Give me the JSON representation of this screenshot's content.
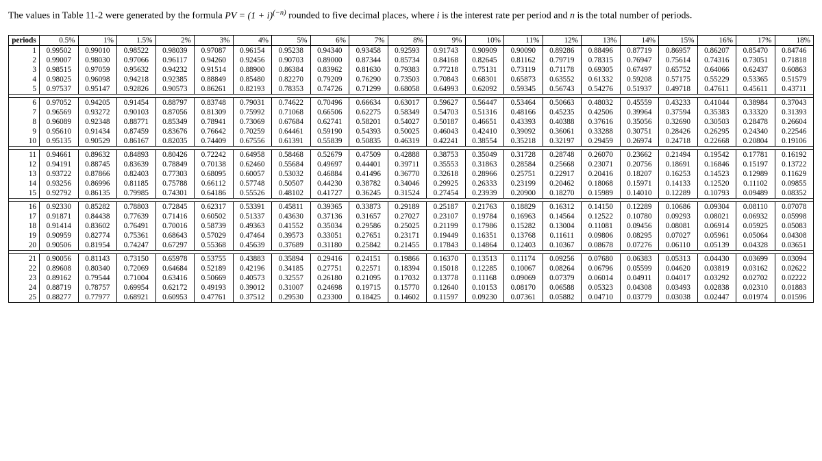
{
  "intro_before": "The values in Table 11-2 were generated by the formula ",
  "intro_formula_html": "PV = (1 + i)<span class='sup'>(−n)</span>",
  "intro_after": " rounded to five decimal places, where ",
  "intro_i": "i",
  "intro_mid": " is the interest rate per period and ",
  "intro_n": "n",
  "intro_end": " is the total number of periods.",
  "periods_label": "periods",
  "rates": [
    "0.5%",
    "1%",
    "1.5%",
    "2%",
    "3%",
    "4%",
    "5%",
    "6%",
    "7%",
    "8%",
    "9%",
    "10%",
    "11%",
    "12%",
    "13%",
    "14%",
    "15%",
    "16%",
    "17%",
    "18%"
  ],
  "chart_data": {
    "type": "table",
    "title": "Present Value Interest Factors PV = (1+i)^(-n)",
    "columns": [
      "periods",
      "0.5%",
      "1%",
      "1.5%",
      "2%",
      "3%",
      "4%",
      "5%",
      "6%",
      "7%",
      "8%",
      "9%",
      "10%",
      "11%",
      "12%",
      "13%",
      "14%",
      "15%",
      "16%",
      "17%",
      "18%"
    ],
    "groups": [
      {
        "periods": [
          1,
          2,
          3,
          4,
          5
        ],
        "rows": [
          [
            "0.99502",
            "0.99010",
            "0.98522",
            "0.98039",
            "0.97087",
            "0.96154",
            "0.95238",
            "0.94340",
            "0.93458",
            "0.92593",
            "0.91743",
            "0.90909",
            "0.90090",
            "0.89286",
            "0.88496",
            "0.87719",
            "0.86957",
            "0.86207",
            "0.85470",
            "0.84746"
          ],
          [
            "0.99007",
            "0.98030",
            "0.97066",
            "0.96117",
            "0.94260",
            "0.92456",
            "0.90703",
            "0.89000",
            "0.87344",
            "0.85734",
            "0.84168",
            "0.82645",
            "0.81162",
            "0.79719",
            "0.78315",
            "0.76947",
            "0.75614",
            "0.74316",
            "0.73051",
            "0.71818"
          ],
          [
            "0.98515",
            "0.97059",
            "0.95632",
            "0.94232",
            "0.91514",
            "0.88900",
            "0.86384",
            "0.83962",
            "0.81630",
            "0.79383",
            "0.77218",
            "0.75131",
            "0.73119",
            "0.71178",
            "0.69305",
            "0.67497",
            "0.65752",
            "0.64066",
            "0.62437",
            "0.60863"
          ],
          [
            "0.98025",
            "0.96098",
            "0.94218",
            "0.92385",
            "0.88849",
            "0.85480",
            "0.82270",
            "0.79209",
            "0.76290",
            "0.73503",
            "0.70843",
            "0.68301",
            "0.65873",
            "0.63552",
            "0.61332",
            "0.59208",
            "0.57175",
            "0.55229",
            "0.53365",
            "0.51579"
          ],
          [
            "0.97537",
            "0.95147",
            "0.92826",
            "0.90573",
            "0.86261",
            "0.82193",
            "0.78353",
            "0.74726",
            "0.71299",
            "0.68058",
            "0.64993",
            "0.62092",
            "0.59345",
            "0.56743",
            "0.54276",
            "0.51937",
            "0.49718",
            "0.47611",
            "0.45611",
            "0.43711"
          ]
        ]
      },
      {
        "periods": [
          6,
          7,
          8,
          9,
          10
        ],
        "rows": [
          [
            "0.97052",
            "0.94205",
            "0.91454",
            "0.88797",
            "0.83748",
            "0.79031",
            "0.74622",
            "0.70496",
            "0.66634",
            "0.63017",
            "0.59627",
            "0.56447",
            "0.53464",
            "0.50663",
            "0.48032",
            "0.45559",
            "0.43233",
            "0.41044",
            "0.38984",
            "0.37043"
          ],
          [
            "0.96569",
            "0.93272",
            "0.90103",
            "0.87056",
            "0.81309",
            "0.75992",
            "0.71068",
            "0.66506",
            "0.62275",
            "0.58349",
            "0.54703",
            "0.51316",
            "0.48166",
            "0.45235",
            "0.42506",
            "0.39964",
            "0.37594",
            "0.35383",
            "0.33320",
            "0.31393"
          ],
          [
            "0.96089",
            "0.92348",
            "0.88771",
            "0.85349",
            "0.78941",
            "0.73069",
            "0.67684",
            "0.62741",
            "0.58201",
            "0.54027",
            "0.50187",
            "0.46651",
            "0.43393",
            "0.40388",
            "0.37616",
            "0.35056",
            "0.32690",
            "0.30503",
            "0.28478",
            "0.26604"
          ],
          [
            "0.95610",
            "0.91434",
            "0.87459",
            "0.83676",
            "0.76642",
            "0.70259",
            "0.64461",
            "0.59190",
            "0.54393",
            "0.50025",
            "0.46043",
            "0.42410",
            "0.39092",
            "0.36061",
            "0.33288",
            "0.30751",
            "0.28426",
            "0.26295",
            "0.24340",
            "0.22546"
          ],
          [
            "0.95135",
            "0.90529",
            "0.86167",
            "0.82035",
            "0.74409",
            "0.67556",
            "0.61391",
            "0.55839",
            "0.50835",
            "0.46319",
            "0.42241",
            "0.38554",
            "0.35218",
            "0.32197",
            "0.29459",
            "0.26974",
            "0.24718",
            "0.22668",
            "0.20804",
            "0.19106"
          ]
        ]
      },
      {
        "periods": [
          11,
          12,
          13,
          14,
          15
        ],
        "rows": [
          [
            "0.94661",
            "0.89632",
            "0.84893",
            "0.80426",
            "0.72242",
            "0.64958",
            "0.58468",
            "0.52679",
            "0.47509",
            "0.42888",
            "0.38753",
            "0.35049",
            "0.31728",
            "0.28748",
            "0.26070",
            "0.23662",
            "0.21494",
            "0.19542",
            "0.17781",
            "0.16192"
          ],
          [
            "0.94191",
            "0.88745",
            "0.83639",
            "0.78849",
            "0.70138",
            "0.62460",
            "0.55684",
            "0.49697",
            "0.44401",
            "0.39711",
            "0.35553",
            "0.31863",
            "0.28584",
            "0.25668",
            "0.23071",
            "0.20756",
            "0.18691",
            "0.16846",
            "0.15197",
            "0.13722"
          ],
          [
            "0.93722",
            "0.87866",
            "0.82403",
            "0.77303",
            "0.68095",
            "0.60057",
            "0.53032",
            "0.46884",
            "0.41496",
            "0.36770",
            "0.32618",
            "0.28966",
            "0.25751",
            "0.22917",
            "0.20416",
            "0.18207",
            "0.16253",
            "0.14523",
            "0.12989",
            "0.11629"
          ],
          [
            "0.93256",
            "0.86996",
            "0.81185",
            "0.75788",
            "0.66112",
            "0.57748",
            "0.50507",
            "0.44230",
            "0.38782",
            "0.34046",
            "0.29925",
            "0.26333",
            "0.23199",
            "0.20462",
            "0.18068",
            "0.15971",
            "0.14133",
            "0.12520",
            "0.11102",
            "0.09855"
          ],
          [
            "0.92792",
            "0.86135",
            "0.79985",
            "0.74301",
            "0.64186",
            "0.55526",
            "0.48102",
            "0.41727",
            "0.36245",
            "0.31524",
            "0.27454",
            "0.23939",
            "0.20900",
            "0.18270",
            "0.15989",
            "0.14010",
            "0.12289",
            "0.10793",
            "0.09489",
            "0.08352"
          ]
        ]
      },
      {
        "periods": [
          16,
          17,
          18,
          19,
          20
        ],
        "rows": [
          [
            "0.92330",
            "0.85282",
            "0.78803",
            "0.72845",
            "0.62317",
            "0.53391",
            "0.45811",
            "0.39365",
            "0.33873",
            "0.29189",
            "0.25187",
            "0.21763",
            "0.18829",
            "0.16312",
            "0.14150",
            "0.12289",
            "0.10686",
            "0.09304",
            "0.08110",
            "0.07078"
          ],
          [
            "0.91871",
            "0.84438",
            "0.77639",
            "0.71416",
            "0.60502",
            "0.51337",
            "0.43630",
            "0.37136",
            "0.31657",
            "0.27027",
            "0.23107",
            "0.19784",
            "0.16963",
            "0.14564",
            "0.12522",
            "0.10780",
            "0.09293",
            "0.08021",
            "0.06932",
            "0.05998"
          ],
          [
            "0.91414",
            "0.83602",
            "0.76491",
            "0.70016",
            "0.58739",
            "0.49363",
            "0.41552",
            "0.35034",
            "0.29586",
            "0.25025",
            "0.21199",
            "0.17986",
            "0.15282",
            "0.13004",
            "0.11081",
            "0.09456",
            "0.08081",
            "0.06914",
            "0.05925",
            "0.05083"
          ],
          [
            "0.90959",
            "0.82774",
            "0.75361",
            "0.68643",
            "0.57029",
            "0.47464",
            "0.39573",
            "0.33051",
            "0.27651",
            "0.23171",
            "0.19449",
            "0.16351",
            "0.13768",
            "0.11611",
            "0.09806",
            "0.08295",
            "0.07027",
            "0.05961",
            "0.05064",
            "0.04308"
          ],
          [
            "0.90506",
            "0.81954",
            "0.74247",
            "0.67297",
            "0.55368",
            "0.45639",
            "0.37689",
            "0.31180",
            "0.25842",
            "0.21455",
            "0.17843",
            "0.14864",
            "0.12403",
            "0.10367",
            "0.08678",
            "0.07276",
            "0.06110",
            "0.05139",
            "0.04328",
            "0.03651"
          ]
        ]
      },
      {
        "periods": [
          21,
          22,
          23,
          24,
          25
        ],
        "rows": [
          [
            "0.90056",
            "0.81143",
            "0.73150",
            "0.65978",
            "0.53755",
            "0.43883",
            "0.35894",
            "0.29416",
            "0.24151",
            "0.19866",
            "0.16370",
            "0.13513",
            "0.11174",
            "0.09256",
            "0.07680",
            "0.06383",
            "0.05313",
            "0.04430",
            "0.03699",
            "0.03094"
          ],
          [
            "0.89608",
            "0.80340",
            "0.72069",
            "0.64684",
            "0.52189",
            "0.42196",
            "0.34185",
            "0.27751",
            "0.22571",
            "0.18394",
            "0.15018",
            "0.12285",
            "0.10067",
            "0.08264",
            "0.06796",
            "0.05599",
            "0.04620",
            "0.03819",
            "0.03162",
            "0.02622"
          ],
          [
            "0.89162",
            "0.79544",
            "0.71004",
            "0.63416",
            "0.50669",
            "0.40573",
            "0.32557",
            "0.26180",
            "0.21095",
            "0.17032",
            "0.13778",
            "0.11168",
            "0.09069",
            "0.07379",
            "0.06014",
            "0.04911",
            "0.04017",
            "0.03292",
            "0.02702",
            "0.02222"
          ],
          [
            "0.88719",
            "0.78757",
            "0.69954",
            "0.62172",
            "0.49193",
            "0.39012",
            "0.31007",
            "0.24698",
            "0.19715",
            "0.15770",
            "0.12640",
            "0.10153",
            "0.08170",
            "0.06588",
            "0.05323",
            "0.04308",
            "0.03493",
            "0.02838",
            "0.02310",
            "0.01883"
          ],
          [
            "0.88277",
            "0.77977",
            "0.68921",
            "0.60953",
            "0.47761",
            "0.37512",
            "0.29530",
            "0.23300",
            "0.18425",
            "0.14602",
            "0.11597",
            "0.09230",
            "0.07361",
            "0.05882",
            "0.04710",
            "0.03779",
            "0.03038",
            "0.02447",
            "0.01974",
            "0.01596"
          ]
        ]
      }
    ]
  }
}
